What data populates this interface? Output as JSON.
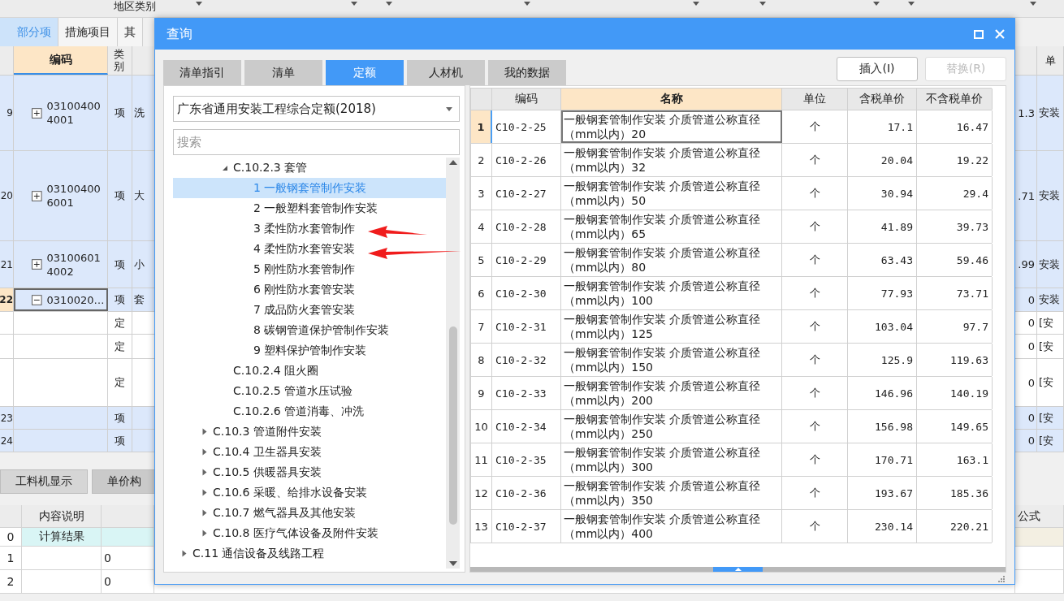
{
  "app": {
    "region_label": "地区类别",
    "tabs": [
      {
        "label": "部分项",
        "selected": true
      },
      {
        "label": "措施项目",
        "selected": false
      },
      {
        "label": "其",
        "selected": false
      }
    ],
    "header": {
      "code": "编码",
      "type": "类别",
      "unit": "单"
    },
    "rows": [
      {
        "index": "9",
        "code": "031004004001",
        "type": "项",
        "name": "洗",
        "price": "1.3",
        "unit": "安装",
        "kind": "item",
        "expanded": false,
        "selected": false
      },
      {
        "index": "20",
        "code": "031004006001",
        "type": "项",
        "name": "大",
        "price": ".71",
        "unit": "安装",
        "kind": "item",
        "expanded": false,
        "selected": false
      },
      {
        "index": "21",
        "code": "031006014002",
        "type": "项",
        "name": "小",
        "price": ".99",
        "unit": "安装",
        "kind": "item",
        "expanded": false,
        "selected": false
      },
      {
        "index": "22",
        "code": "0310020…",
        "type": "项",
        "name": "套",
        "price": "0",
        "unit": "安装",
        "kind": "item",
        "expanded": true,
        "selected": true
      },
      {
        "type": "定",
        "price": "0",
        "unit": "[安",
        "kind": "quota",
        "selected": false
      },
      {
        "type": "定",
        "price": "0",
        "unit": "[安",
        "kind": "quota",
        "selected": false
      },
      {
        "type": "定",
        "price": "0",
        "unit": "[安",
        "kind": "quota",
        "selected": false
      },
      {
        "index": "23",
        "type": "项",
        "price": "0",
        "unit": "[安",
        "kind": "item",
        "selected": false
      },
      {
        "index": "24",
        "type": "项",
        "price": "0",
        "unit": "[安",
        "kind": "item",
        "selected": false
      }
    ],
    "bottom_tabs": [
      {
        "label": "工料机显示",
        "selected": true
      },
      {
        "label": "单价构",
        "selected": false
      }
    ],
    "bottom_table": {
      "columns": [
        "内容说明",
        "公式"
      ],
      "rows": [
        {
          "index": "0",
          "description": "计算结果"
        },
        {
          "index": "1",
          "value": "0"
        },
        {
          "index": "2",
          "value": "0"
        }
      ]
    }
  },
  "dialog": {
    "title": "查询",
    "tabs": [
      {
        "label": "清单指引",
        "selected": false
      },
      {
        "label": "清单",
        "selected": false
      },
      {
        "label": "定额",
        "selected": true
      },
      {
        "label": "人材机",
        "selected": false
      },
      {
        "label": "我的数据",
        "selected": false
      }
    ],
    "buttons": [
      {
        "label": "插入(I)",
        "disabled": false
      },
      {
        "label": "替换(R)",
        "disabled": true
      }
    ],
    "library": "广东省通用安装工程综合定额(2018)",
    "search": {
      "placeholder": "搜索"
    },
    "tree": [
      {
        "children": [
          {
            "children": [
              {
                "label": "C.10.2.3 套管",
                "expanded": true,
                "selected": false,
                "children": [
                  {
                    "label": "1 一般钢套管制作安装",
                    "selected": true
                  },
                  {
                    "label": "2 一般塑料套管制作安装",
                    "selected": false
                  },
                  {
                    "label": "3 柔性防水套管制作",
                    "selected": false
                  },
                  {
                    "label": "4 柔性防水套管安装",
                    "selected": false
                  },
                  {
                    "label": "5 刚性防水套管制作",
                    "selected": false
                  },
                  {
                    "label": "6 刚性防水套管安装",
                    "selected": false
                  },
                  {
                    "label": "7 成品防火套管安装",
                    "selected": false
                  },
                  {
                    "label": "8 碳钢管道保护管制作安装",
                    "selected": false
                  },
                  {
                    "label": "9 塑料保护管制作安装",
                    "selected": false
                  }
                ]
              },
              {
                "label": "C.10.2.4 阻火圈",
                "selected": false
              },
              {
                "label": "C.10.2.5 管道水压试验",
                "selected": false
              },
              {
                "label": "C.10.2.6 管道消毒、冲洗",
                "selected": false
              }
            ]
          },
          {
            "label": "C.10.3 管道附件安装",
            "expanded": false,
            "selected": false
          },
          {
            "label": "C.10.4 卫生器具安装",
            "expanded": false,
            "selected": false
          },
          {
            "label": "C.10.5 供暖器具安装",
            "expanded": false,
            "selected": false
          },
          {
            "label": "C.10.6 采暖、给排水设备安装",
            "expanded": false,
            "selected": false
          },
          {
            "label": "C.10.7 燃气器具及其他安装",
            "expanded": false,
            "selected": false
          },
          {
            "label": "C.10.8 医疗气体设备及附件安装",
            "expanded": false,
            "selected": false
          }
        ]
      },
      {
        "label": "C.11 通信设备及线路工程",
        "expanded": false,
        "selected": false
      }
    ],
    "table": {
      "columns": [
        {
          "label": "编码",
          "highlighted": false
        },
        {
          "label": "名称",
          "highlighted": true
        },
        {
          "label": "单位",
          "highlighted": false
        },
        {
          "label": "含税单价",
          "highlighted": false
        },
        {
          "label": "不含税单价",
          "highlighted": false
        }
      ],
      "rows": [
        {
          "index": "1",
          "code": "C10-2-25",
          "name": "一般钢套管制作安装 介质管道公称直径（mm以内）20",
          "unit": "个",
          "price_tax": "17.1",
          "price": "16.47",
          "selected": true
        },
        {
          "index": "2",
          "code": "C10-2-26",
          "name": "一般钢套管制作安装 介质管道公称直径（mm以内）32",
          "unit": "个",
          "price_tax": "20.04",
          "price": "19.22",
          "selected": false
        },
        {
          "index": "3",
          "code": "C10-2-27",
          "name": "一般钢套管制作安装 介质管道公称直径（mm以内）50",
          "unit": "个",
          "price_tax": "30.94",
          "price": "29.4",
          "selected": false
        },
        {
          "index": "4",
          "code": "C10-2-28",
          "name": "一般钢套管制作安装 介质管道公称直径（mm以内）65",
          "unit": "个",
          "price_tax": "41.89",
          "price": "39.73",
          "selected": false
        },
        {
          "index": "5",
          "code": "C10-2-29",
          "name": "一般钢套管制作安装 介质管道公称直径（mm以内）80",
          "unit": "个",
          "price_tax": "63.43",
          "price": "59.46",
          "selected": false
        },
        {
          "index": "6",
          "code": "C10-2-30",
          "name": "一般钢套管制作安装 介质管道公称直径（mm以内）100",
          "unit": "个",
          "price_tax": "77.93",
          "price": "73.71",
          "selected": false
        },
        {
          "index": "7",
          "code": "C10-2-31",
          "name": "一般钢套管制作安装 介质管道公称直径（mm以内）125",
          "unit": "个",
          "price_tax": "103.04",
          "price": "97.7",
          "selected": false
        },
        {
          "index": "8",
          "code": "C10-2-32",
          "name": "一般钢套管制作安装 介质管道公称直径（mm以内）150",
          "unit": "个",
          "price_tax": "125.9",
          "price": "119.63",
          "selected": false
        },
        {
          "index": "9",
          "code": "C10-2-33",
          "name": "一般钢套管制作安装 介质管道公称直径（mm以内）200",
          "unit": "个",
          "price_tax": "146.96",
          "price": "140.19",
          "selected": false
        },
        {
          "index": "10",
          "code": "C10-2-34",
          "name": "一般钢套管制作安装 介质管道公称直径（mm以内）250",
          "unit": "个",
          "price_tax": "156.98",
          "price": "149.65",
          "selected": false
        },
        {
          "index": "11",
          "code": "C10-2-35",
          "name": "一般钢套管制作安装 介质管道公称直径（mm以内）300",
          "unit": "个",
          "price_tax": "170.71",
          "price": "163.1",
          "selected": false
        },
        {
          "index": "12",
          "code": "C10-2-36",
          "name": "一般钢套管制作安装 介质管道公称直径（mm以内）350",
          "unit": "个",
          "price_tax": "193.67",
          "price": "185.36",
          "selected": false
        },
        {
          "index": "13",
          "code": "C10-2-37",
          "name": "一般钢套管制作安装 介质管道公称直径（mm以内）400",
          "unit": "个",
          "price_tax": "230.14",
          "price": "220.21",
          "selected": false
        }
      ]
    }
  }
}
